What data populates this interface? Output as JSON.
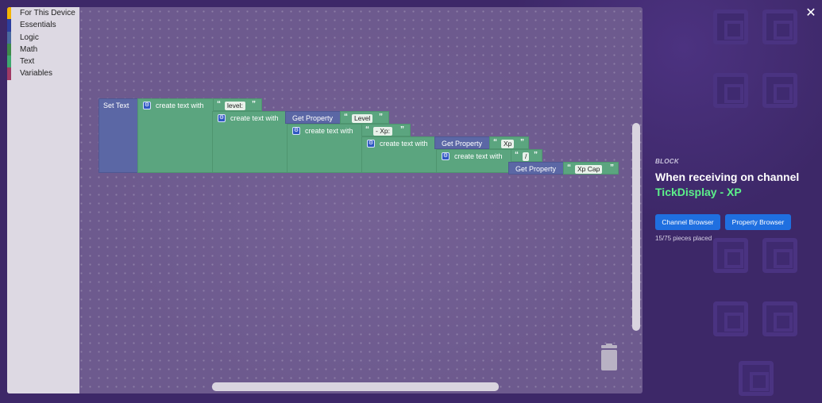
{
  "toolbox": {
    "categories": [
      {
        "label": "For This Device",
        "color": "#f4b400"
      },
      {
        "label": "Essentials",
        "color": "#2c3e9e"
      },
      {
        "label": "Logic",
        "color": "#4a6aa0"
      },
      {
        "label": "Math",
        "color": "#3e8a4a"
      },
      {
        "label": "Text",
        "color": "#3ea86e"
      },
      {
        "label": "Variables",
        "color": "#a03a64"
      }
    ]
  },
  "blocks": {
    "set_text": "Set Text",
    "create_text_with": "create text with",
    "get_property": "Get Property",
    "strings": {
      "level_label": "level:",
      "xp_label": "- Xp:",
      "slash": "/"
    },
    "properties": {
      "level": "Level",
      "xp": "Xp",
      "xp_cap": "Xp Cap"
    },
    "open_quote": "“",
    "close_quote": "”"
  },
  "panel": {
    "kicker": "BLOCK",
    "title": "When receiving on channel",
    "channel": "TickDisplay - XP",
    "channel_browser": "Channel Browser",
    "property_browser": "Property Browser",
    "pieces_placed": "15/75 pieces placed",
    "close": "✕"
  },
  "colors": {
    "set_text_block": "#5b67a5",
    "text_block": "#5ba57f",
    "channel_accent": "#5cf08a",
    "button": "#1f6fe0"
  }
}
